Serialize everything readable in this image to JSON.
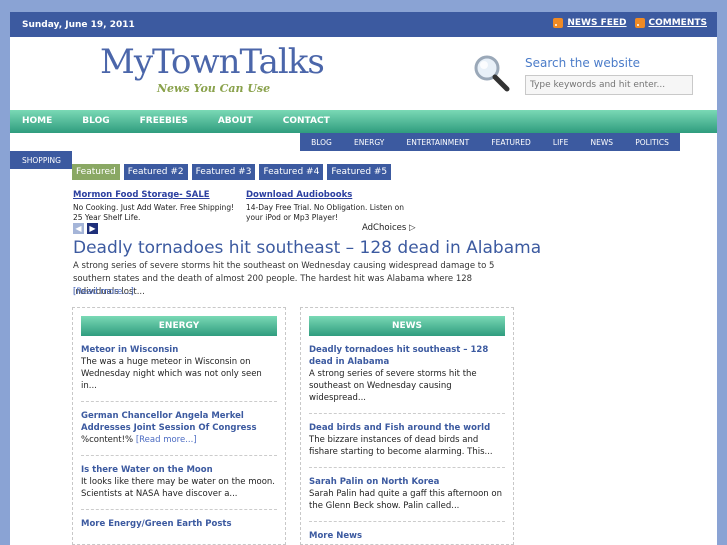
{
  "topbar": {
    "date": "Sunday, June 19, 2011",
    "news_feed": "NEWS FEED",
    "comments": "COMMENTS"
  },
  "brand": {
    "logo": "MyTownTalks",
    "tagline": "News You Can Use"
  },
  "search": {
    "title": "Search the website",
    "placeholder": "Type keywords and hit enter..."
  },
  "nav": [
    "HOME",
    "BLOG",
    "FREEBIES",
    "ABOUT",
    "CONTACT"
  ],
  "subnav": [
    "BLOG",
    "ENERGY",
    "ENTERTAINMENT",
    "FEATURED",
    "LIFE",
    "NEWS",
    "POLITICS"
  ],
  "shopping": "SHOPPING",
  "featured_tabs": [
    "Featured",
    "Featured #2",
    "Featured #3",
    "Featured #4",
    "Featured #5"
  ],
  "ads": [
    {
      "title": "Mormon Food Storage- SALE",
      "text": "No Cooking. Just Add Water. Free Shipping! 25 Year Shelf Life."
    },
    {
      "title": "Download Audiobooks",
      "text": "14-Day Free Trial. No Obligation. Listen on your iPod or Mp3 Player!"
    }
  ],
  "adchoices": "AdChoices ▷",
  "feature": {
    "headline": "Deadly tornadoes hit southeast – 128 dead in Alabama",
    "summary": "A strong series of severe storms hit the southeast on Wednesday causing widespread damage to 5 southern states and the death of almost 200 people. The hardest hit was Alabama where 128 individuals lost...",
    "read_more": "[Read more...]"
  },
  "energy": {
    "header": "ENERGY",
    "posts": [
      {
        "title": "Meteor in Wisconsin",
        "text": "The was a huge meteor in Wisconsin on Wednesday night which was not only seen in...",
        "more": ""
      },
      {
        "title": "German Chancellor Angela Merkel Addresses Joint Session Of Congress",
        "text": "%content!% ",
        "more": "[Read more...]"
      },
      {
        "title": "Is there Water on the Moon",
        "text": "It looks like there may be water on the moon. Scientists at NASA have discover a...",
        "more": ""
      }
    ],
    "more_link": "More Energy/Green Earth Posts"
  },
  "news": {
    "header": "NEWS",
    "posts": [
      {
        "title": "Deadly tornadoes hit southeast – 128 dead in Alabama",
        "text": "A strong series of severe storms hit the southeast on Wednesday causing widespread...",
        "more": ""
      },
      {
        "title": "Dead birds and Fish around the world",
        "text": "The bizzare instances of dead birds and fishare starting to become alarming. This...",
        "more": ""
      },
      {
        "title": "Sarah Palin on North Korea",
        "text": "Sarah Palin had quite a gaff this afternoon on the Glenn Beck show. Palin called...",
        "more": ""
      }
    ],
    "more_link": "More News"
  }
}
